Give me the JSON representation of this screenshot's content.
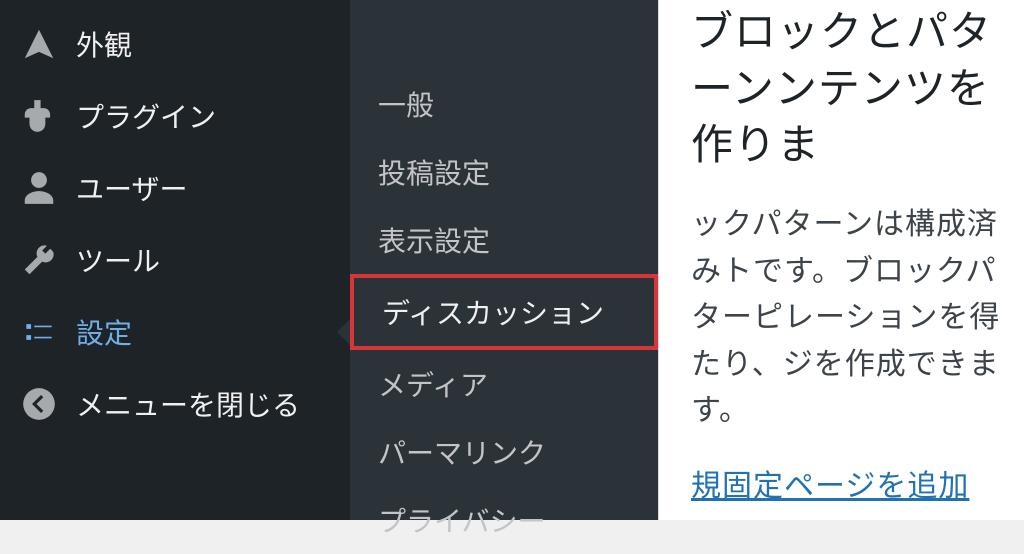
{
  "sidebar": {
    "items": [
      {
        "label": "外観",
        "icon": "appearance-icon"
      },
      {
        "label": "プラグイン",
        "icon": "plugins-icon"
      },
      {
        "label": "ユーザー",
        "icon": "users-icon"
      },
      {
        "label": "ツール",
        "icon": "tools-icon"
      },
      {
        "label": "設定",
        "icon": "settings-icon",
        "active": true
      },
      {
        "label": "メニューを閉じる",
        "icon": "collapse-icon"
      }
    ]
  },
  "submenu": {
    "items": [
      {
        "label": "一般"
      },
      {
        "label": "投稿設定"
      },
      {
        "label": "表示設定"
      },
      {
        "label": "ディスカッション",
        "highlight": true
      },
      {
        "label": "メディア"
      },
      {
        "label": "パーマリンク"
      },
      {
        "label": "プライバシー"
      }
    ]
  },
  "content": {
    "heading": "ブロックとパターンンテンツを作りま",
    "paragraph": "ックパターンは構成済みトです。ブロックパターピレーションを得たり、ジを作成できます。",
    "link": "規固定ページを追加"
  }
}
